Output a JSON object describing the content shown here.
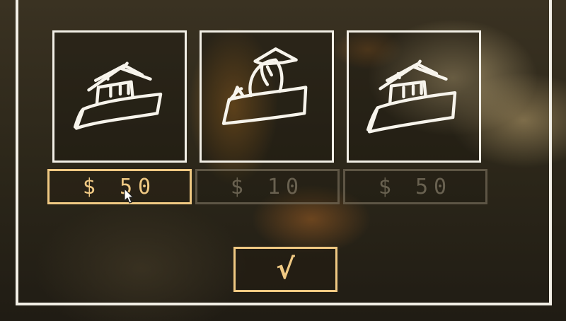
{
  "ships": [
    {
      "icon": "ship-with-house-icon",
      "price": "$ 50",
      "selected": true
    },
    {
      "icon": "ship-with-sail-icon",
      "price": "$ 10",
      "selected": false
    },
    {
      "icon": "ship-with-house-icon",
      "price": "$ 50",
      "selected": false
    }
  ],
  "confirm": {
    "label": "√",
    "icon": "checkmark-icon"
  },
  "colors": {
    "frame": "#f2efe6",
    "accent": "#f0c983",
    "dim": "#8c826e"
  }
}
